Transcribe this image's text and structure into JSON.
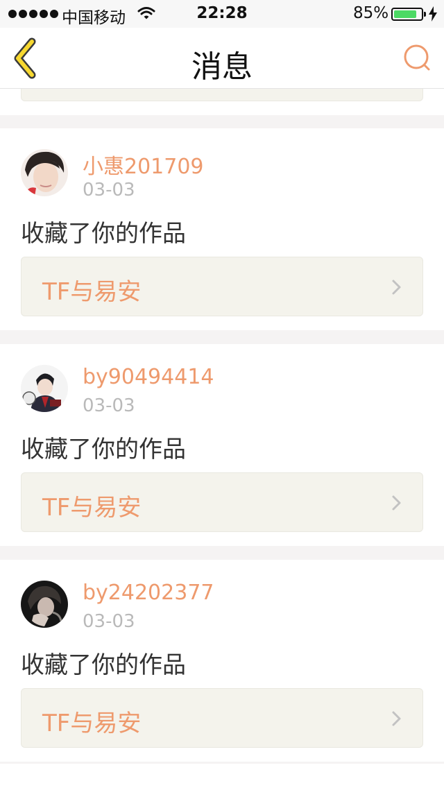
{
  "status_bar": {
    "carrier": "中国移动",
    "time": "22:28",
    "battery_percent": "85%",
    "battery_level": 0.85,
    "signal_bars": 5
  },
  "nav": {
    "title": "消息",
    "back_icon": "chevron-left-icon",
    "search_icon": "search-icon",
    "accent_color": "#ee9a6d"
  },
  "messages": [
    {
      "username": "小惠201709",
      "date": "03-03",
      "action": "收藏了你的作品",
      "work_title": "TF与易安"
    },
    {
      "username": "by90494414",
      "date": "03-03",
      "action": "收藏了你的作品",
      "work_title": "TF与易安"
    },
    {
      "username": "by24202377",
      "date": "03-03",
      "action": "收藏了你的作品",
      "work_title": "TF与易安"
    }
  ]
}
